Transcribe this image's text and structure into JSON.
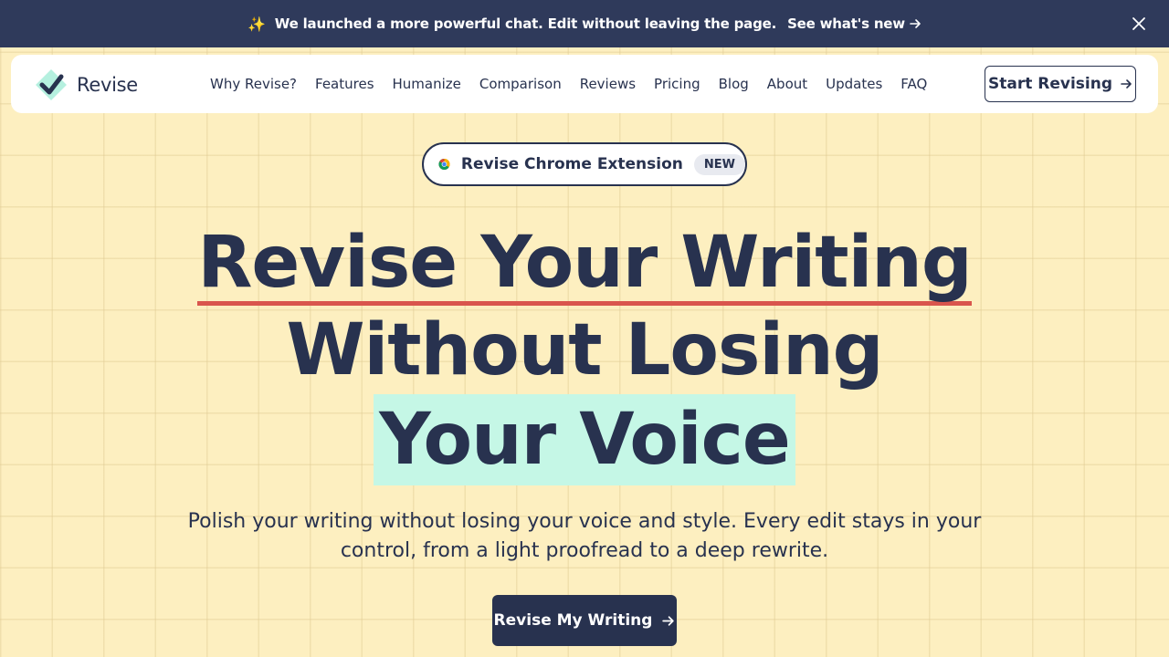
{
  "banner": {
    "sparkle_icon": "✨",
    "message": "We launched a more powerful chat. Edit without leaving the page.",
    "link_label": "See what's new",
    "close_icon": "close-icon"
  },
  "navbar": {
    "brand_name": "Revise",
    "links": [
      "Why Revise?",
      "Features",
      "Humanize",
      "Comparison",
      "Reviews",
      "Pricing",
      "Blog",
      "About",
      "Updates",
      "FAQ"
    ],
    "cta_label": "Start Revising"
  },
  "extension": {
    "label": "Revise Chrome Extension",
    "badge": "NEW"
  },
  "hero": {
    "line1": "Revise Your Writing",
    "line2": "Without Losing",
    "line3": "Your Voice",
    "subheadline": "Polish your writing without losing your voice and style. Every edit stays in your control, from a light proofread to a deep rewrite.",
    "cta_label": "Revise My Writing"
  },
  "colors": {
    "background": "#fdefc0",
    "banner": "#2f3a5b",
    "navy": "#28324f",
    "underline": "#d9564d",
    "highlight": "#c5f7e6",
    "brand_accent": "#b5f0df"
  }
}
